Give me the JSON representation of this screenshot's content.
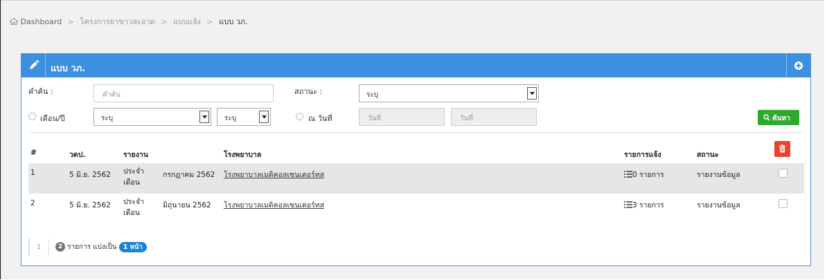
{
  "breadcrumb": {
    "home": "Dashboard",
    "section": "โครงการยาขาวสะอาด",
    "page": "แบบแจ้ง",
    "current": "แบบ วภ."
  },
  "panel": {
    "title": "แบบ วภ."
  },
  "filters": {
    "keyword_label": "คำค้น :",
    "keyword_placeholder": "คำค้น",
    "status_label": "สถานะ :",
    "status_value": "ระบุ",
    "monthyear_label": "เดือน/ปี",
    "month_value": "ระบุ",
    "year_value": "ระบุ",
    "date_label": "ณ วันที่",
    "date_from_placeholder": "วันที่",
    "date_to_placeholder": "วันที่",
    "search_label": "ค้นหา"
  },
  "table": {
    "columns": {
      "num": "#",
      "date": "วดป.",
      "report": "รายงาน",
      "hospital": "โรงพยาบาล",
      "items": "รายการแจ้ง",
      "status": "สถานะ"
    },
    "rows": [
      {
        "num": "1",
        "date": "5 มิ.ย. 2562",
        "type": "ประจำ เดือน",
        "period": "กรกฎาคม 2562",
        "hospital": "โรงพยาบาลเมดิคอลเซนเตอร์ทส",
        "items": "0 รายการ",
        "status": "รายงานข้อมูล"
      },
      {
        "num": "2",
        "date": "5 มิ.ย. 2562",
        "type": "ประจำ เดือน",
        "period": "มิถุนายน 2562",
        "hospital": "โรงพยาบาลเมดิคอลเซนเตอร์ทส",
        "items": "3 รายการ",
        "status": "รายงานข้อมูล"
      }
    ]
  },
  "pagination": {
    "page": "1",
    "total_count": "2",
    "text": "รายการ แบ่งเป็น",
    "pages": "1 หน้า"
  },
  "colors": {
    "header_blue": "#3d8fe0",
    "search_green": "#2ea92e",
    "delete_red": "#e8432e",
    "badge_blue": "#1c82d8"
  }
}
